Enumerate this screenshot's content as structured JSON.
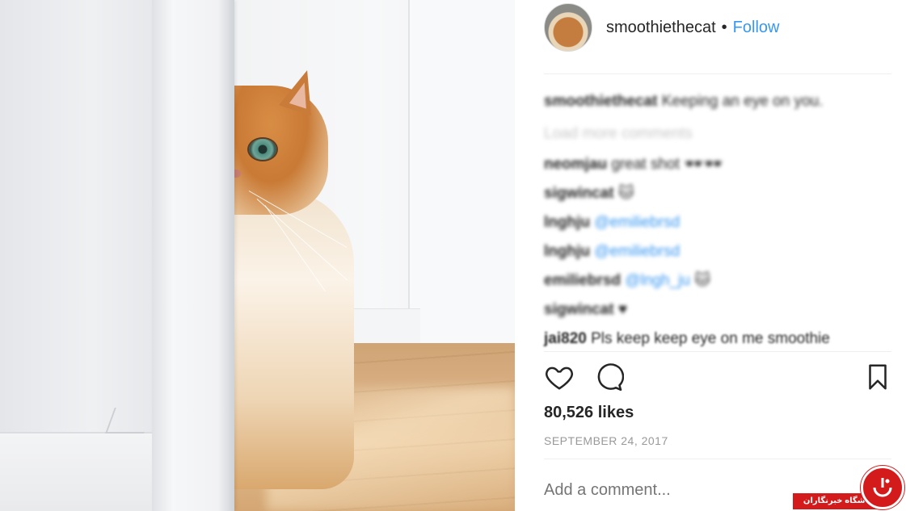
{
  "post": {
    "photo_alt": "",
    "header": {
      "username": "smoothiethecat",
      "separator": "•",
      "follow_label": "Follow"
    },
    "caption": {
      "username": "smoothiethecat",
      "text": "Keeping an eye on you."
    },
    "load_more_label": "Load more comments",
    "comments": [
      {
        "username": "neomjau",
        "text": "great shot 🕶🕶"
      },
      {
        "username": "sigwincat",
        "text": "🐱"
      },
      {
        "username": "lnghju",
        "mention": "@emiliebrsd"
      },
      {
        "username": "lnghju",
        "mention": "@emiliebrsd"
      },
      {
        "username": "emiliebrsd",
        "mention": "@lngh_ju",
        "text": "🐱"
      },
      {
        "username": "sigwincat",
        "text": "♥"
      },
      {
        "username": "jai820",
        "text": "Pls keep keep eye on me smoothie"
      }
    ],
    "likes_text": "80,526 likes",
    "date_text": "SEPTEMBER 24, 2017",
    "add_comment_placeholder": "Add a comment...",
    "icons": {
      "like": "heart-icon",
      "comment": "speech-bubble-icon",
      "save": "bookmark-icon"
    },
    "colors": {
      "link_blue": "#3897f0",
      "text": "#262626",
      "muted": "#999999",
      "separator": "#efefef"
    }
  },
  "watermark": {
    "text": "باشگاه خبرنگاران"
  }
}
